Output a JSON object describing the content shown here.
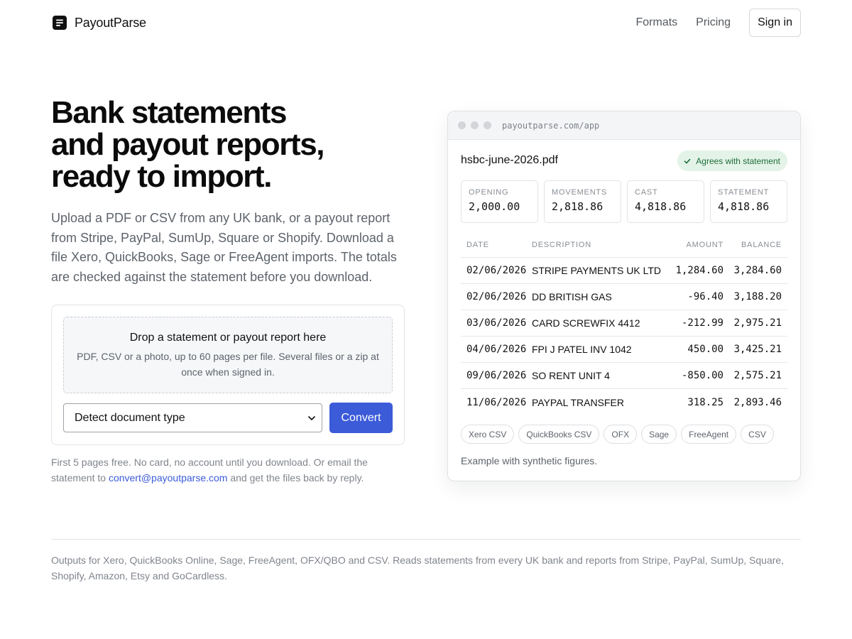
{
  "header": {
    "brand": "PayoutParse",
    "logo_icon": "document-lines-icon",
    "nav": [
      {
        "label": "Formats"
      },
      {
        "label": "Pricing"
      }
    ],
    "signin_label": "Sign in"
  },
  "hero": {
    "title_lines": [
      "Bank statements",
      "and payout reports,",
      "ready to import."
    ],
    "description": "Upload a PDF or CSV from any UK bank, or a payout report from Stripe, PayPal, SumUp, Square or Shopify. Download a file Xero, QuickBooks, Sage or FreeAgent imports. The totals are checked against the statement before you download."
  },
  "upload": {
    "drop_title": "Drop a statement or payout report here",
    "drop_subtitle": "PDF, CSV or a photo, up to 60 pages per file. Several files or a zip at once when signed in.",
    "select_value": "Detect document type",
    "convert_label": "Convert",
    "accent_color": "#3b5bd9"
  },
  "fineprint": {
    "before": "First 5 pages free. No card, no account until you download. Or email the statement to ",
    "email": "convert@payoutparse.com",
    "after": " and get the files back by reply."
  },
  "preview": {
    "url": "payoutparse.com/app",
    "filename": "hsbc-june-2026.pdf",
    "badge": "Agrees with statement",
    "badge_icon": "check-icon",
    "stats": [
      {
        "label": "OPENING",
        "value": "2,000.00"
      },
      {
        "label": "MOVEMENTS",
        "value": "2,818.86"
      },
      {
        "label": "CAST",
        "value": "4,818.86"
      },
      {
        "label": "STATEMENT",
        "value": "4,818.86"
      }
    ],
    "table": {
      "columns": [
        "DATE",
        "DESCRIPTION",
        "AMOUNT",
        "BALANCE"
      ],
      "rows": [
        [
          "02/06/2026",
          "STRIPE PAYMENTS UK LTD",
          "1,284.60",
          "3,284.60"
        ],
        [
          "02/06/2026",
          "DD BRITISH GAS",
          "-96.40",
          "3,188.20"
        ],
        [
          "03/06/2026",
          "CARD SCREWFIX 4412",
          "-212.99",
          "2,975.21"
        ],
        [
          "04/06/2026",
          "FPI J PATEL INV 1042",
          "450.00",
          "3,425.21"
        ],
        [
          "09/06/2026",
          "SO RENT UNIT 4",
          "-850.00",
          "2,575.21"
        ],
        [
          "11/06/2026",
          "PAYPAL TRANSFER",
          "318.25",
          "2,893.46"
        ]
      ]
    },
    "formats": [
      "Xero CSV",
      "QuickBooks CSV",
      "OFX",
      "Sage",
      "FreeAgent",
      "CSV"
    ],
    "note": "Example with synthetic figures."
  },
  "footer": {
    "text": "Outputs for Xero, QuickBooks Online, Sage, FreeAgent, OFX/QBO and CSV. Reads statements from every UK bank and reports from Stripe, PayPal, SumUp, Square, Shopify, Amazon, Etsy and GoCardless."
  }
}
